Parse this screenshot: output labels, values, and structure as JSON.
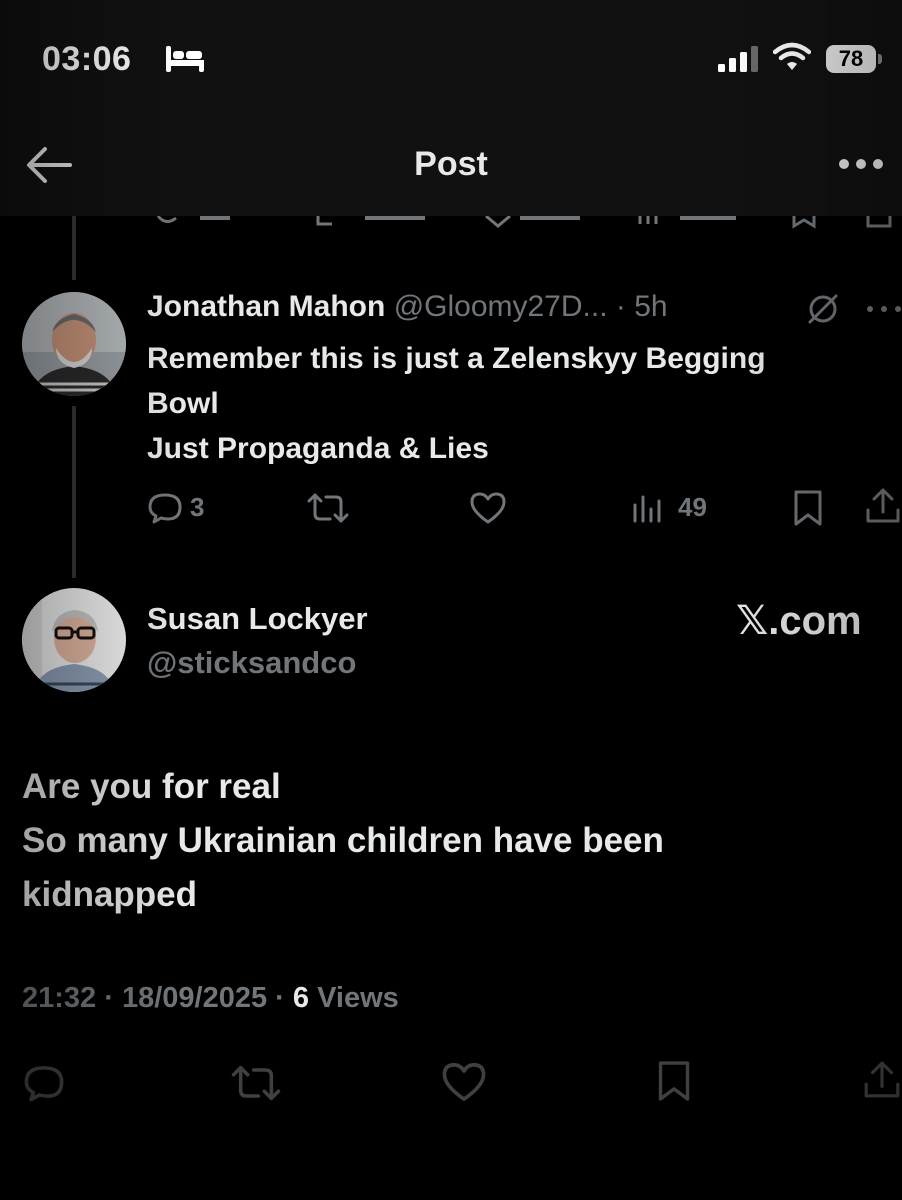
{
  "status_bar": {
    "time": "03:06",
    "battery": "78",
    "icons": [
      "bed-icon",
      "signal-icon",
      "wifi-icon",
      "battery-icon"
    ]
  },
  "header": {
    "title": "Post",
    "icons": [
      "back-arrow-icon",
      "more-icon"
    ]
  },
  "reply": {
    "name": "Jonathan Mahon",
    "handle": "@Gloomy27D...",
    "time": "5h",
    "text_lines": [
      "Remember this is just a Zelenskyy Begging",
      "Bowl",
      "Just Propaganda & Lies"
    ],
    "actions": {
      "replies": "3",
      "views": "49"
    }
  },
  "main_post": {
    "name": "Susan Lockyer",
    "handle": "@sticksandco",
    "watermark": "𝕏.com",
    "text_lines": [
      "Are you for real",
      "So many Ukrainian children have been",
      "kidnapped"
    ],
    "time": "21:32",
    "date": "18/09/2025",
    "views_count": "6",
    "views_label": "Views"
  },
  "colors": {
    "background": "#000000",
    "text": "#e7e9ea",
    "secondary": "#71767b",
    "header": "#111111"
  }
}
